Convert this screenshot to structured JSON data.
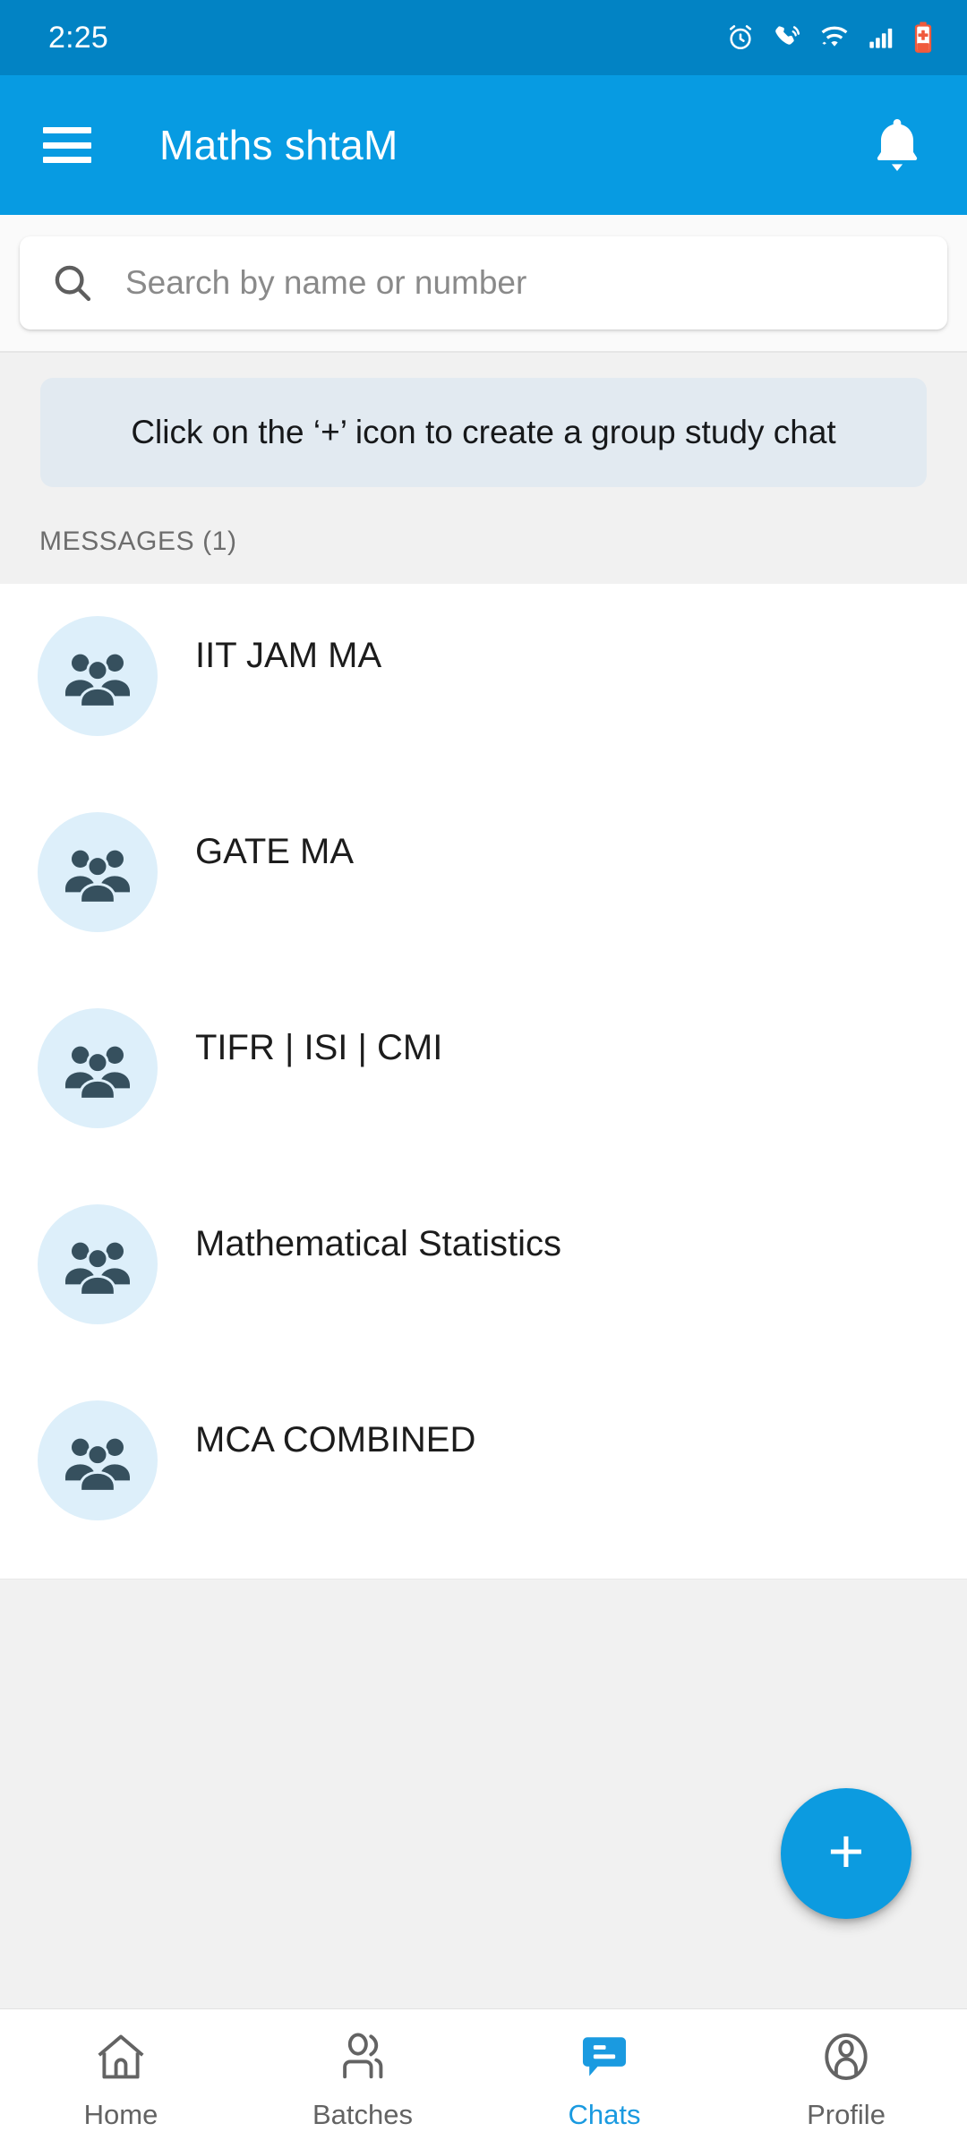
{
  "status_bar": {
    "time": "2:25",
    "icons": [
      "alarm-clock-icon",
      "missed-call-icon",
      "wifi-icon",
      "cellular-signal-icon",
      "battery-charging-icon"
    ],
    "background_color": "#0283C4",
    "text_color": "#FFFFFF"
  },
  "app_bar": {
    "title": "Maths shtaM",
    "menu_icon": "hamburger-menu-icon",
    "notification_icon": "bell-icon",
    "background_color": "#079BE2"
  },
  "search": {
    "placeholder": "Search by name or number",
    "value": "",
    "icon": "search-icon"
  },
  "banner": {
    "text": "Click on the ‘+’ icon to create a group study chat",
    "background_color": "#E2EAF1"
  },
  "section": {
    "label": "MESSAGES (1)"
  },
  "chats": [
    {
      "title": "IIT JAM MA",
      "avatar_icon": "group-people-icon"
    },
    {
      "title": "GATE MA",
      "avatar_icon": "group-people-icon"
    },
    {
      "title": "TIFR | ISI | CMI",
      "avatar_icon": "group-people-icon"
    },
    {
      "title": "Mathematical Statistics",
      "avatar_icon": "group-people-icon"
    },
    {
      "title": "MCA COMBINED",
      "avatar_icon": "group-people-icon"
    }
  ],
  "fab": {
    "label": "+",
    "icon": "plus-icon",
    "color": "#0C9BE0"
  },
  "bottom_nav": {
    "active_color": "#1A9AE0",
    "inactive_color": "#636363",
    "items": [
      {
        "label": "Home",
        "icon": "home-icon",
        "active": false
      },
      {
        "label": "Batches",
        "icon": "people-group-icon",
        "active": false
      },
      {
        "label": "Chats",
        "icon": "chat-bubble-icon",
        "active": true
      },
      {
        "label": "Profile",
        "icon": "person-icon",
        "active": false
      }
    ]
  }
}
